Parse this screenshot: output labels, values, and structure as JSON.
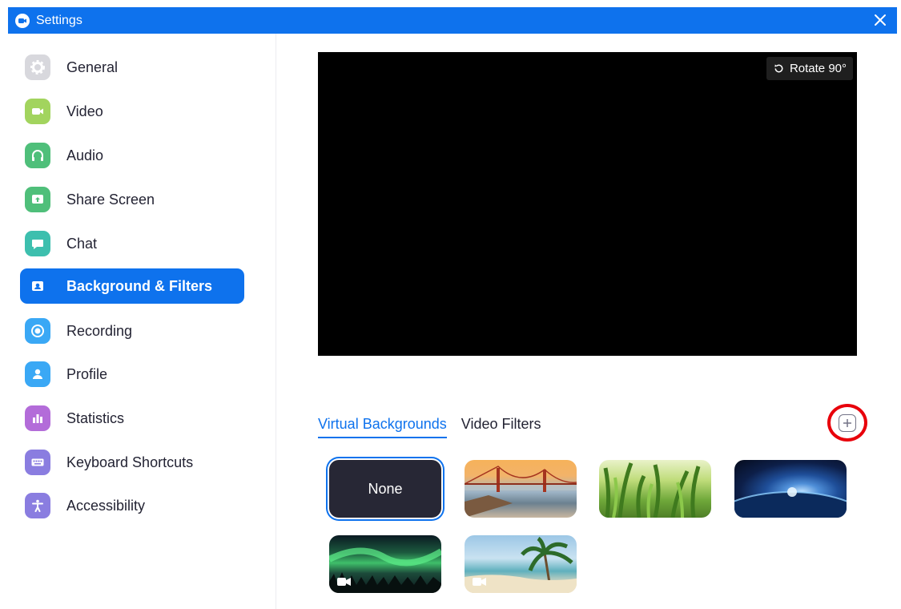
{
  "window": {
    "title": "Settings"
  },
  "sidebar": {
    "items": [
      {
        "label": "General",
        "icon": "gear-icon",
        "color": "#b0b0b8",
        "active": false
      },
      {
        "label": "Video",
        "icon": "camera-icon",
        "color": "#a2d45e",
        "active": false
      },
      {
        "label": "Audio",
        "icon": "headphones-icon",
        "color": "#4fbf7a",
        "active": false
      },
      {
        "label": "Share Screen",
        "icon": "share-screen-icon",
        "color": "#4fbf7a",
        "active": false
      },
      {
        "label": "Chat",
        "icon": "chat-bubble-icon",
        "color": "#3dbfae",
        "active": false
      },
      {
        "label": "Background & Filters",
        "icon": "portrait-icon",
        "color": "#0e72ed",
        "active": true
      },
      {
        "label": "Recording",
        "icon": "record-icon",
        "color": "#3aa8f5",
        "active": false
      },
      {
        "label": "Profile",
        "icon": "user-icon",
        "color": "#3aa8f5",
        "active": false
      },
      {
        "label": "Statistics",
        "icon": "bar-chart-icon",
        "color": "#b36cd9",
        "active": false
      },
      {
        "label": "Keyboard Shortcuts",
        "icon": "keyboard-icon",
        "color": "#8a7de0",
        "active": false
      },
      {
        "label": "Accessibility",
        "icon": "accessibility-icon",
        "color": "#8a7de0",
        "active": false
      }
    ]
  },
  "preview": {
    "rotate_label": "Rotate 90°"
  },
  "tabs": [
    {
      "label": "Virtual Backgrounds",
      "active": true
    },
    {
      "label": "Video Filters",
      "active": false
    }
  ],
  "add_button": {
    "icon": "plus-icon",
    "highlight_color": "#e8000b"
  },
  "backgrounds": [
    {
      "label": "None",
      "selected": true
    },
    {
      "scene": "golden-gate-bridge",
      "video": false
    },
    {
      "scene": "grass",
      "video": false
    },
    {
      "scene": "earth-from-space",
      "video": false
    },
    {
      "scene": "aurora",
      "video": true
    },
    {
      "scene": "beach",
      "video": true
    }
  ],
  "colors": {
    "accent": "#0e72ed",
    "text": "#232333"
  }
}
